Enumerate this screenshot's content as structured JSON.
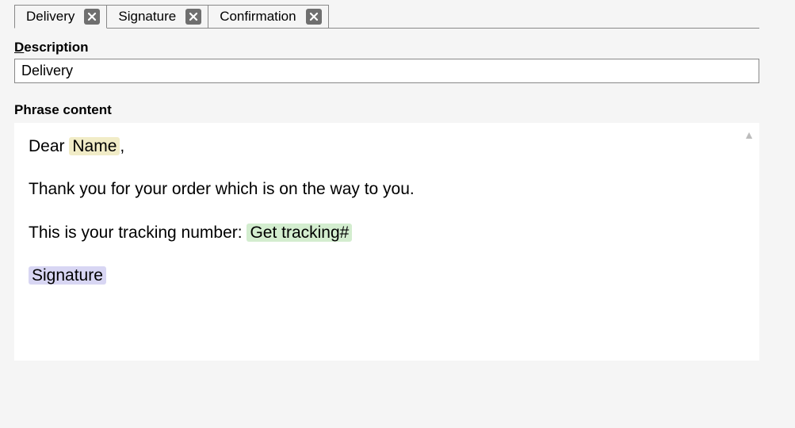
{
  "tabs": [
    {
      "label": "Delivery",
      "active": true
    },
    {
      "label": "Signature",
      "active": false
    },
    {
      "label": "Confirmation",
      "active": false
    }
  ],
  "descriptionLabel": {
    "prefix": "D",
    "rest": "escription"
  },
  "descriptionValue": "Delivery",
  "phraseLabel": "Phrase content",
  "content": {
    "line1_prefix": "Dear ",
    "line1_token": "Name",
    "line1_suffix": ",",
    "line2": "Thank you for your order which is on the way to you.",
    "line3_prefix": "This is your tracking number: ",
    "line3_token": "Get tracking#",
    "line4_token": "Signature"
  },
  "tokenColors": {
    "name": "#f1ecc7",
    "tracking": "#d3edcf",
    "signature": "#d8d6f3"
  }
}
